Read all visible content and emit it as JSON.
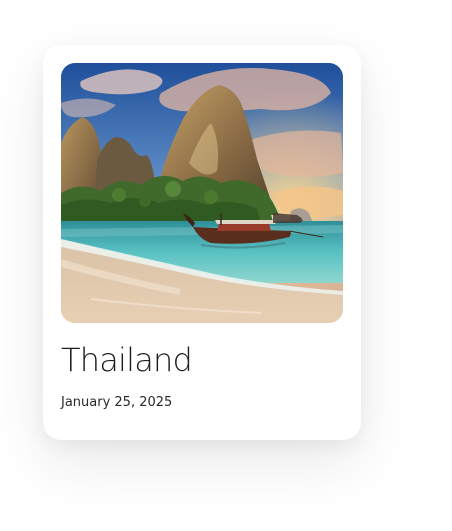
{
  "card": {
    "title": "Thailand",
    "date": "January 25, 2025"
  },
  "colors": {
    "card_background": "#ffffff",
    "title_text": "#1d1d1f",
    "date_text": "#2a2a2c"
  }
}
